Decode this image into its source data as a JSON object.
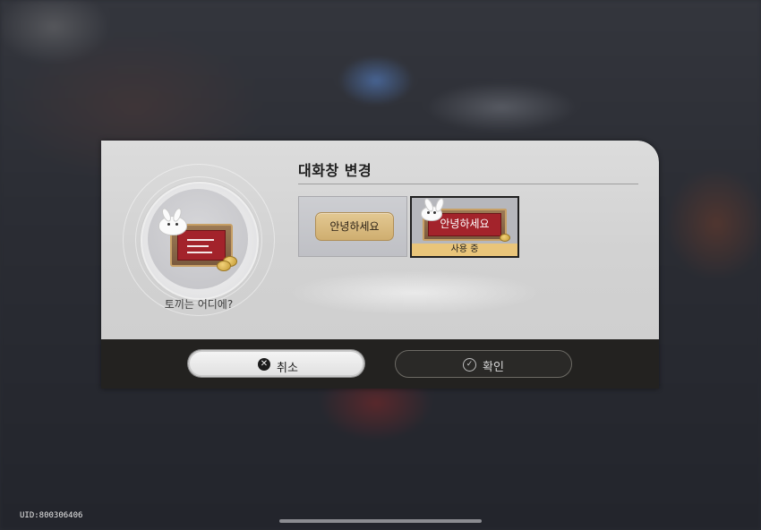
{
  "dialog": {
    "title": "대화창 변경",
    "avatar_name": "토끼는 어디에?",
    "options": [
      {
        "label": "안녕하세요",
        "style": "beige-pill"
      },
      {
        "label": "안녕하세요",
        "style": "red-board",
        "status": "사용 중",
        "selected": true
      }
    ],
    "buttons": {
      "cancel": {
        "label": "취소",
        "icon": "x-circle-icon"
      },
      "confirm": {
        "label": "확인",
        "icon": "check-circle-icon"
      }
    }
  },
  "footer": {
    "uid": "UID:800306406"
  },
  "colors": {
    "accent_gold": "#e9c57a",
    "board_red": "#a3232b",
    "panel_dark": "#232220"
  }
}
